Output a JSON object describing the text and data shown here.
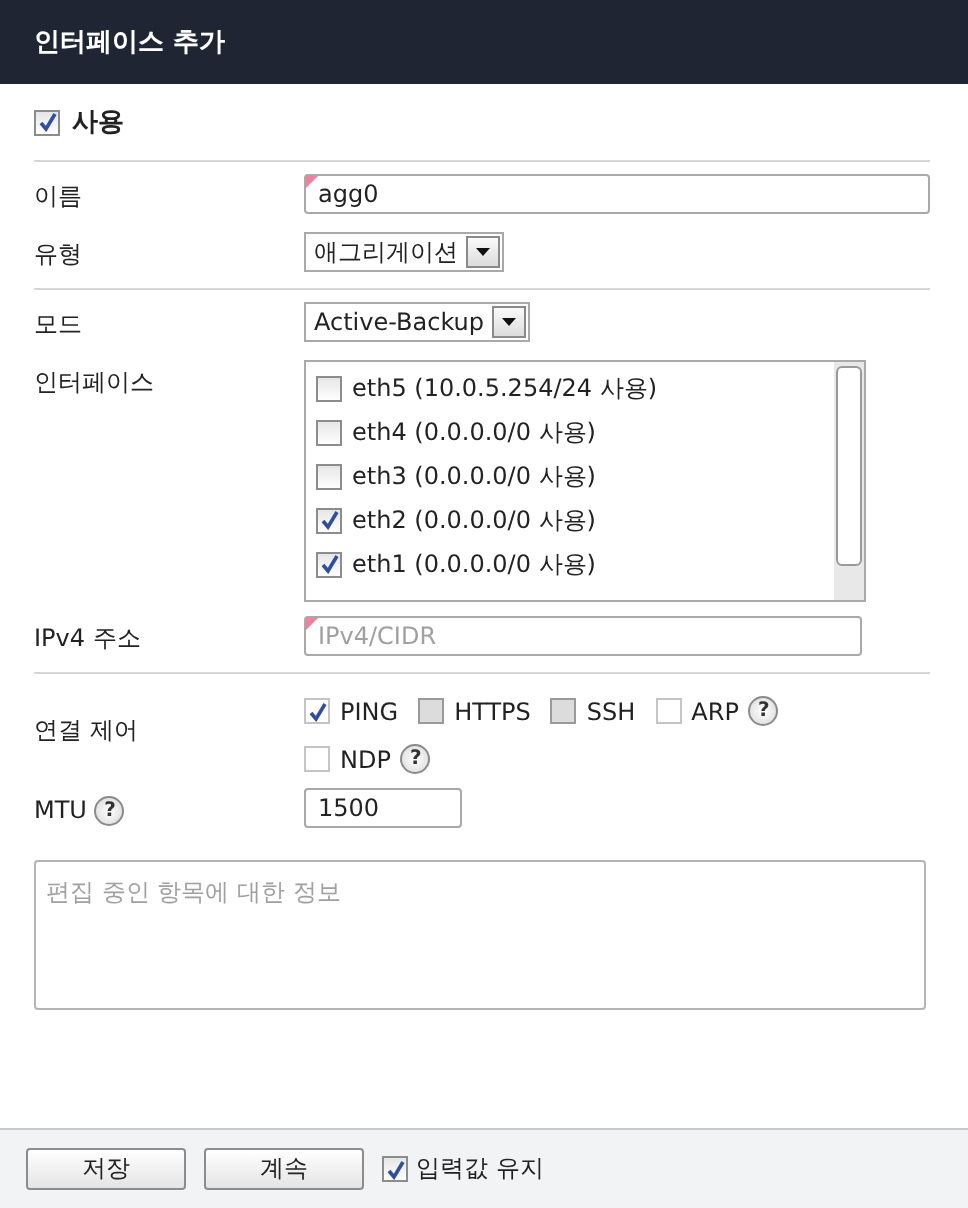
{
  "window": {
    "title": "인터페이스 추가"
  },
  "enabled": {
    "label": "사용",
    "checked": true
  },
  "sections": [
    [
      {
        "kind": "text",
        "label": "이름",
        "value": "agg0",
        "required": true
      },
      {
        "kind": "select",
        "label": "유형",
        "value": "애그리게이션"
      }
    ],
    [
      {
        "kind": "select",
        "label": "모드",
        "value": "Active-Backup"
      },
      {
        "kind": "list",
        "label": "인터페이스",
        "items": [
          {
            "label": "eth5 (10.0.5.254/24 사용)",
            "checked": false
          },
          {
            "label": "eth4 (0.0.0.0/0 사용)",
            "checked": false
          },
          {
            "label": "eth3 (0.0.0.0/0 사용)",
            "checked": false
          },
          {
            "label": "eth2 (0.0.0.0/0 사용)",
            "checked": true
          },
          {
            "label": "eth1 (0.0.0.0/0 사용)",
            "checked": true
          }
        ]
      },
      {
        "kind": "text",
        "label": "IPv4 주소",
        "placeholder": "IPv4/CIDR",
        "required": true
      }
    ],
    [
      {
        "kind": "checks",
        "label": "연결 제어",
        "options": [
          {
            "label": "PING",
            "checked": true,
            "disabled": false
          },
          {
            "label": "HTTPS",
            "checked": false,
            "disabled": true
          },
          {
            "label": "SSH",
            "checked": false,
            "disabled": true
          },
          {
            "label": "ARP",
            "checked": false,
            "disabled": false,
            "help": "?"
          },
          {
            "label": "NDP",
            "checked": false,
            "disabled": false,
            "help": "?"
          }
        ]
      },
      {
        "kind": "number",
        "label": "MTU",
        "help": "?",
        "value": "1500"
      }
    ]
  ],
  "info": {
    "placeholder": "편집 중인 항목에 대한 정보"
  },
  "buttons": [
    "저장",
    "계속"
  ],
  "keep": {
    "label": "입력값 유지",
    "checked": true
  }
}
